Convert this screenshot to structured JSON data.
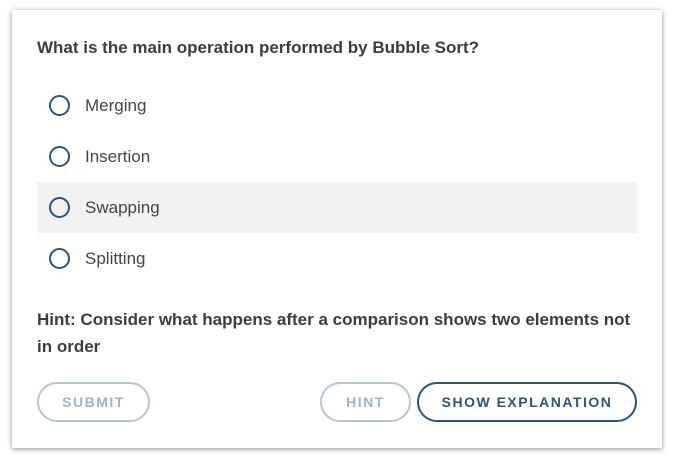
{
  "quiz": {
    "question": "What is the main operation performed by Bubble Sort?",
    "options": [
      {
        "label": "Merging"
      },
      {
        "label": "Insertion"
      },
      {
        "label": "Swapping"
      },
      {
        "label": "Splitting"
      }
    ],
    "hint": "Hint: Consider what happens after a comparison shows two elements not in order"
  },
  "buttons": {
    "submit": "Submit",
    "hint": "Hint",
    "explanation": "Show Explanation"
  },
  "colors": {
    "accent": "#2c5478",
    "disabled": "#b5c6d3",
    "hover_row": "#f2f2f2"
  },
  "state": {
    "hovered_option": "Swapping",
    "submit_enabled": false,
    "hint_enabled": false
  }
}
